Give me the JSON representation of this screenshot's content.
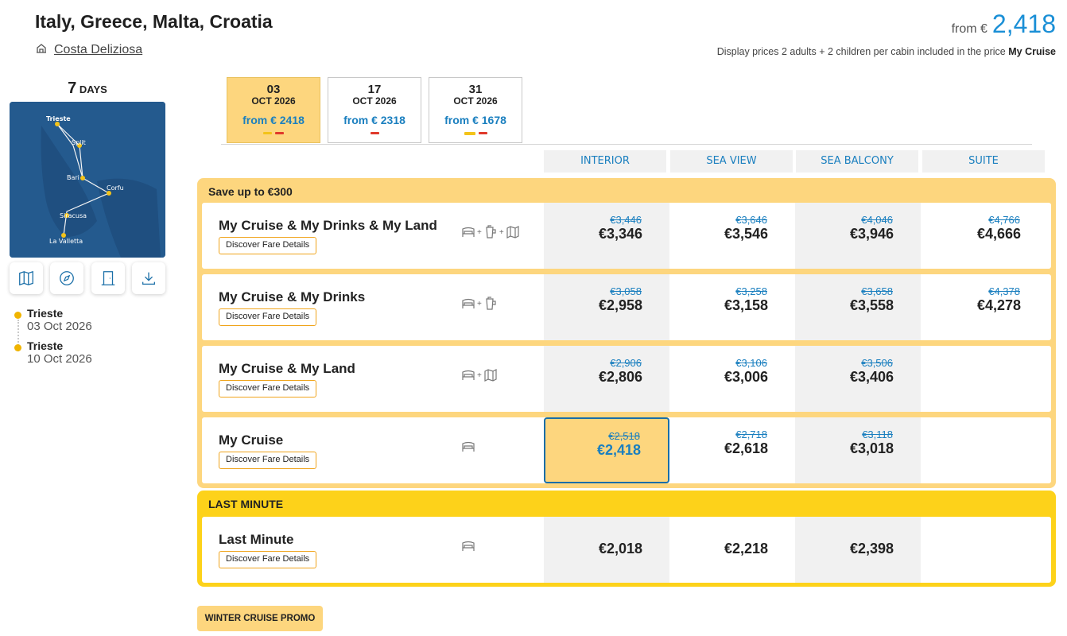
{
  "header": {
    "title": "Italy, Greece, Malta, Croatia",
    "ship": "Costa Deliziosa",
    "from_label": "from €",
    "from_price": "2,418",
    "note_prefix": "Display prices 2 adults + 2 children per cabin included in the price",
    "note_bold": "My Cruise"
  },
  "left": {
    "days_num": "7",
    "days_label": "DAYS",
    "map_ports": [
      "Trieste",
      "Split",
      "Bari",
      "Corfu",
      "Siracusa",
      "La Valletta"
    ],
    "tools": [
      "map-icon",
      "compass-icon",
      "door-icon",
      "download-icon"
    ],
    "itinerary": [
      {
        "port": "Trieste",
        "date": "03 Oct 2026"
      },
      {
        "port": "Trieste",
        "date": "10 Oct 2026"
      }
    ]
  },
  "date_tabs": [
    {
      "day": "03",
      "month": "OCT 2026",
      "price": "from € 2418"
    },
    {
      "day": "17",
      "month": "OCT 2026",
      "price": "from € 2318"
    },
    {
      "day": "31",
      "month": "OCT 2026",
      "price": "from € 1678"
    }
  ],
  "columns": [
    "INTERIOR",
    "SEA VIEW",
    "SEA BALCONY",
    "SUITE"
  ],
  "save_group": {
    "title": "Save up to €300",
    "rows": [
      {
        "name": "My Cruise & My Drinks & My Land",
        "button": "Discover Fare Details",
        "prices": [
          {
            "old": "€3,446",
            "new": "€3,346"
          },
          {
            "old": "€3,646",
            "new": "€3,546"
          },
          {
            "old": "€4,046",
            "new": "€3,946"
          },
          {
            "old": "€4,766",
            "new": "€4,666"
          }
        ]
      },
      {
        "name": "My Cruise & My Drinks",
        "button": "Discover Fare Details",
        "prices": [
          {
            "old": "€3,058",
            "new": "€2,958"
          },
          {
            "old": "€3,258",
            "new": "€3,158"
          },
          {
            "old": "€3,658",
            "new": "€3,558"
          },
          {
            "old": "€4,378",
            "new": "€4,278"
          }
        ]
      },
      {
        "name": "My Cruise & My Land",
        "button": "Discover Fare Details",
        "prices": [
          {
            "old": "€2,906",
            "new": "€2,806"
          },
          {
            "old": "€3,106",
            "new": "€3,006"
          },
          {
            "old": "€3,506",
            "new": "€3,406"
          }
        ]
      },
      {
        "name": "My Cruise",
        "button": "Discover Fare Details",
        "prices": [
          {
            "old": "€2,518",
            "new": "€2,418"
          },
          {
            "old": "€2,718",
            "new": "€2,618"
          },
          {
            "old": "€3,118",
            "new": "€3,018"
          }
        ]
      }
    ]
  },
  "last_group": {
    "title": "LAST MINUTE",
    "row": {
      "name": "Last Minute",
      "button": "Discover Fare Details",
      "prices": [
        "€2,018",
        "€2,218",
        "€2,398"
      ]
    }
  },
  "promo": "WINTER CRUISE PROMO",
  "colors": {
    "accent": "#1a8fd6",
    "save_bg": "#fdd67e",
    "last_bg": "#fdd21a"
  }
}
